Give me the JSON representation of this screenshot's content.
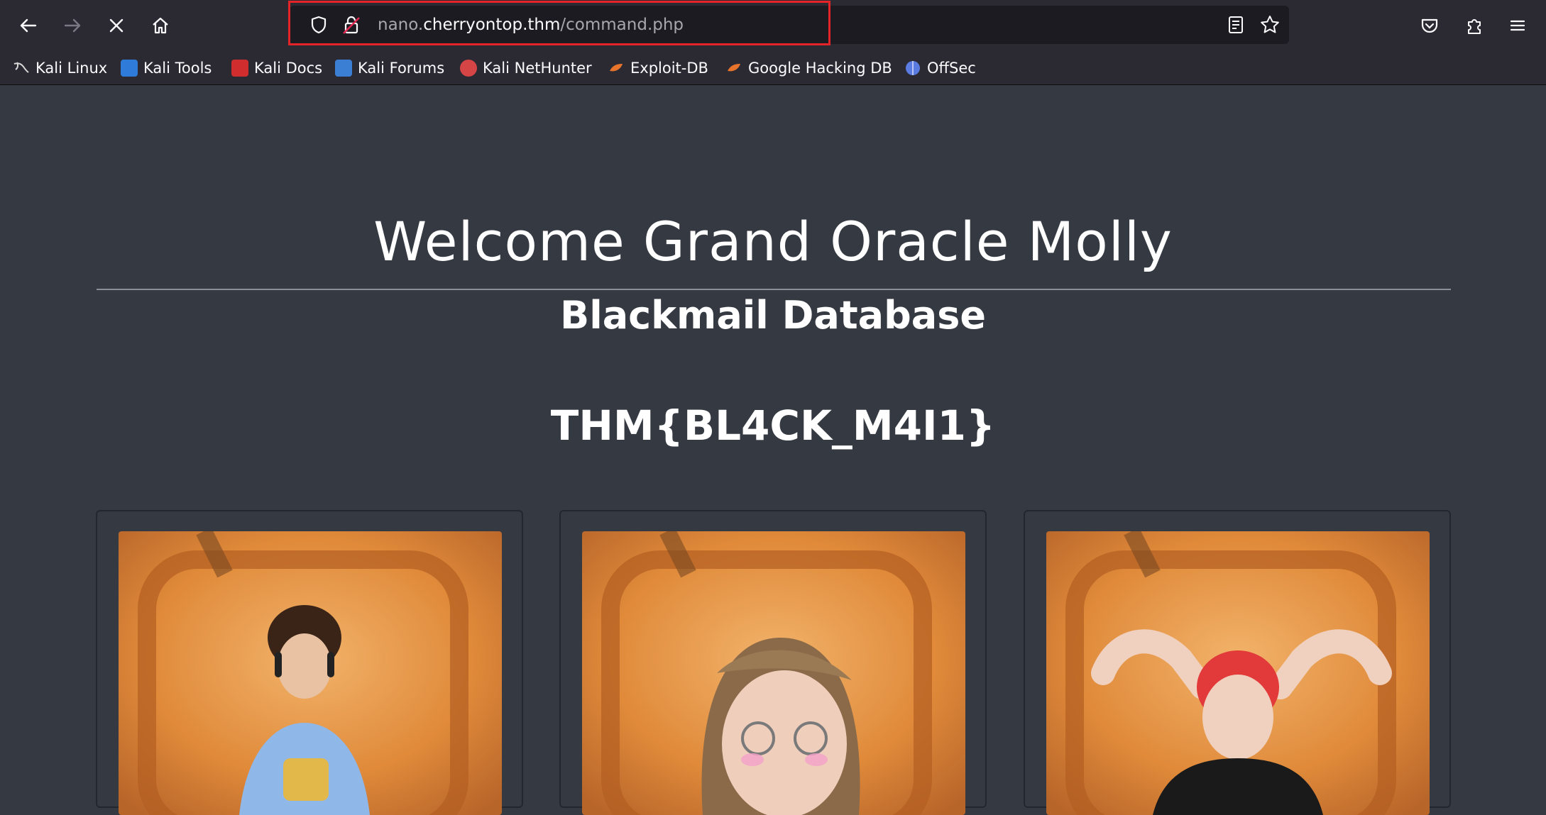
{
  "browser": {
    "url": {
      "prefix": "nano.",
      "host": "cherryontop.thm",
      "path": "/command.php"
    },
    "bookmarks": [
      {
        "label": "Kali Linux",
        "color": "#c7c7c7"
      },
      {
        "label": "Kali Tools",
        "color": "#2f7bd9"
      },
      {
        "label": "Kali Docs",
        "color": "#d02e2e"
      },
      {
        "label": "Kali Forums",
        "color": "#3a7fd4"
      },
      {
        "label": "Kali NetHunter",
        "color": "#d64545"
      },
      {
        "label": "Exploit-DB",
        "color": "#e8742c"
      },
      {
        "label": "Google Hacking DB",
        "color": "#e8742c"
      },
      {
        "label": "OffSec",
        "color": "#5a7be0"
      }
    ]
  },
  "page": {
    "title": "Welcome Grand Oracle Molly",
    "subtitle": "Blackmail Database",
    "flag": "THM{BL4CK_M4I1}"
  },
  "cards": [
    {
      "person": "curly-haired man with headphones",
      "shirt": "#8fb7e8",
      "hair": "#3a2418"
    },
    {
      "person": "woman with glasses and long hair",
      "shirt": "#2a2a2a",
      "hair": "#8a6a48"
    },
    {
      "person": "man with red hair, hands behind head",
      "shirt": "#1a1a1a",
      "hair": "#e23a3a"
    }
  ]
}
